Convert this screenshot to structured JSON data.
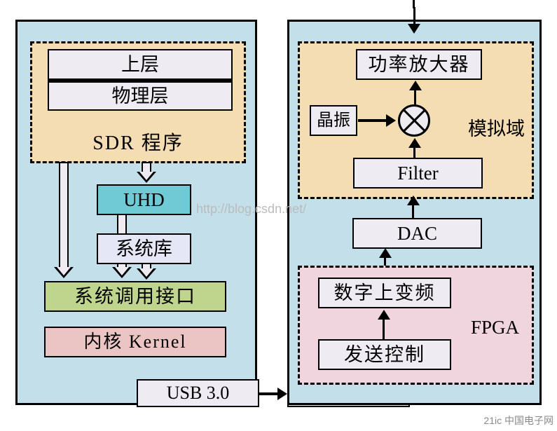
{
  "left": {
    "sdr": {
      "upper": "上层",
      "phys": "物理层",
      "label": "SDR 程序"
    },
    "uhd": "UHD",
    "syslib": "系统库",
    "syscall": "系统调用接口",
    "kernel": "内核 Kernel",
    "usb": "USB 3.0"
  },
  "right": {
    "analog": {
      "pa": "功率放大器",
      "xtal": "晶振",
      "filter": "Filter",
      "label": "模拟域"
    },
    "dac": "DAC",
    "fpga": {
      "duc": "数字上变频",
      "txctrl": "发送控制",
      "label": "FPGA"
    },
    "usb": "USB 3.0"
  },
  "watermark": "http://blog.csdn.net/",
  "logo": "21ic 中国电子网"
}
